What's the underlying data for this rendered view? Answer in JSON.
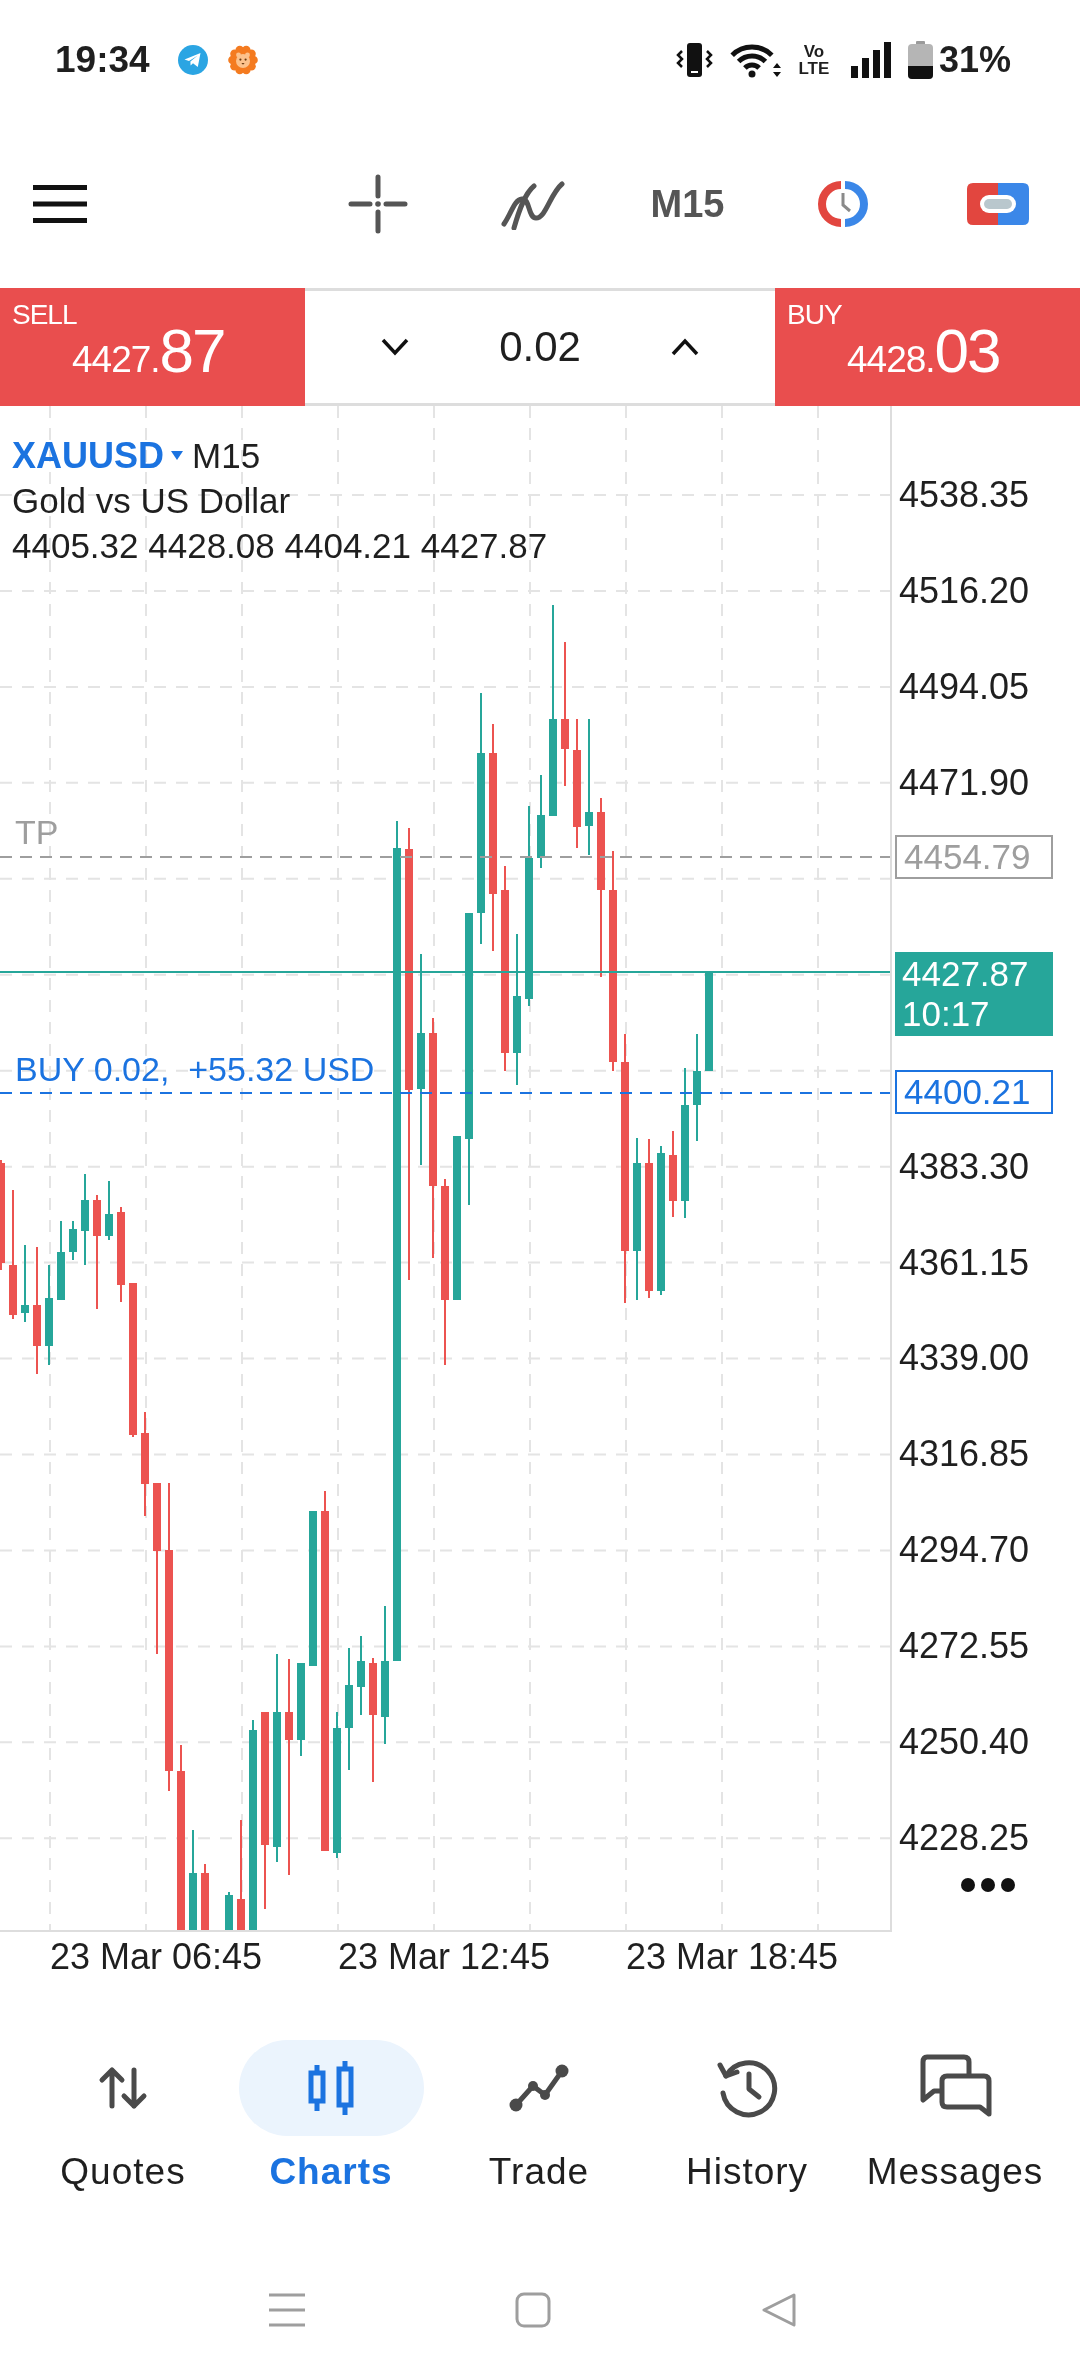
{
  "status_bar": {
    "time": "19:34",
    "network_type": "Vo LTE",
    "battery": "31%"
  },
  "toolbar": {
    "timeframe": "M15"
  },
  "trade_panel": {
    "sell": {
      "label": "SELL",
      "price": "4427.",
      "pips": "87"
    },
    "volume": "0.02",
    "buy": {
      "label": "BUY",
      "price": "4428.",
      "pips": "03"
    }
  },
  "chart": {
    "symbol": "XAUUSD",
    "timeframe": "M15",
    "description": "Gold vs US Dollar",
    "ohlc": "4405.32 4428.08 4404.21 4427.87",
    "take_profit": {
      "label": "TP",
      "price": "4454.79"
    },
    "current_price": {
      "price": "4427.87",
      "countdown": "10:17"
    },
    "position": {
      "label": "BUY 0.02,  +55.32 USD",
      "price": "4400.21"
    },
    "price_axis_upper": [
      "4538.35",
      "4516.20",
      "4494.05",
      "4471.90"
    ],
    "price_axis_lower": [
      "4383.30",
      "4361.15",
      "4339.00",
      "4316.85",
      "4294.70",
      "4272.55",
      "4250.40",
      "4228.25"
    ],
    "time_axis": [
      "23 Mar 06:45",
      "23 Mar 12:45",
      "23 Mar 18:45"
    ]
  },
  "bottom_nav": [
    {
      "label": "Quotes",
      "selected": false
    },
    {
      "label": "Charts",
      "selected": true
    },
    {
      "label": "Trade",
      "selected": false
    },
    {
      "label": "History",
      "selected": false
    },
    {
      "label": "Messages",
      "selected": false
    }
  ]
}
